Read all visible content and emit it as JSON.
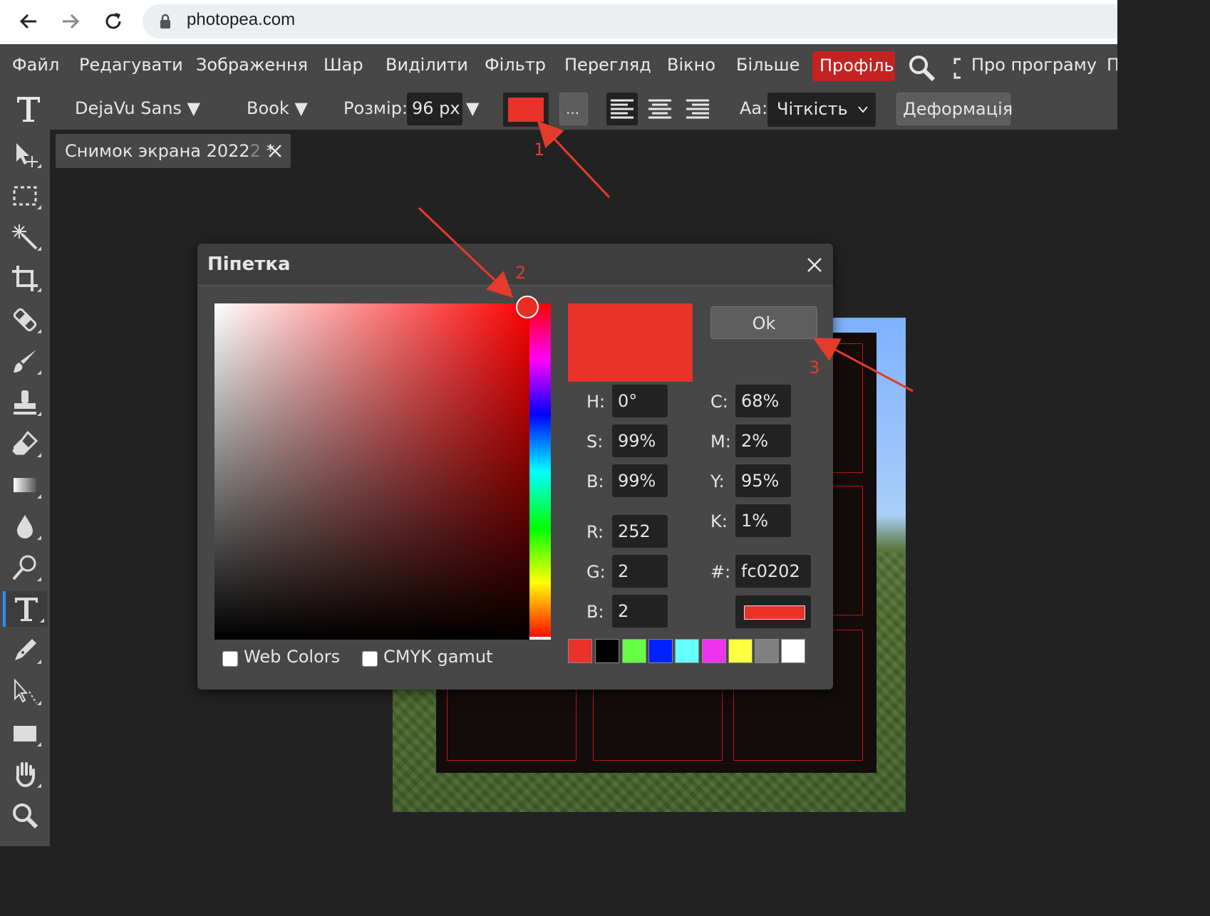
{
  "browser": {
    "url": "photopea.com"
  },
  "menu": {
    "items": [
      "Файл",
      "Редагувати",
      "Зображення",
      "Шар",
      "Виділити",
      "Фільтр",
      "Перегляд",
      "Вікно",
      "Більше"
    ],
    "profile": "Профіль",
    "about": "Про програму",
    "overflow": "П"
  },
  "options": {
    "font_family": "DejaVu Sans",
    "font_style": "Book",
    "size_label": "Розмір:",
    "size_value": "96 px",
    "more_label": "...",
    "aa_label": "Aa:",
    "aa_value": "Чіткість",
    "warp_label": "Деформація",
    "color": "#e8322a"
  },
  "document": {
    "tab_title": "Снимок экрана 2022",
    "tab_title_dim": "2",
    "modified_mark": "*"
  },
  "dialog": {
    "title": "Піпетка",
    "ok_label": "Ok",
    "web_colors_label": "Web Colors",
    "cmyk_gamut_label": "CMYK gamut",
    "preview_color": "#e8322a",
    "fields": {
      "h_label": "H:",
      "h": "0°",
      "s_label": "S:",
      "s": "99%",
      "b_label": "B:",
      "b": "99%",
      "r_label": "R:",
      "r": "252",
      "g_label": "G:",
      "g": "2",
      "b2_label": "B:",
      "b2": "2",
      "c_label": "C:",
      "c": "68%",
      "m_label": "M:",
      "m": "2%",
      "y_label": "Y:",
      "y": "95%",
      "k_label": "K:",
      "k": "1%",
      "hex_label": "#:",
      "hex": "fc0202"
    },
    "swatches": [
      "#e8322a",
      "#000000",
      "#66ff44",
      "#0022ff",
      "#66ffff",
      "#ee33ee",
      "#ffff44",
      "#808080",
      "#ffffff"
    ]
  },
  "annotations": {
    "one": "1",
    "two": "2",
    "three": "3",
    "color": "#e43b2b"
  }
}
